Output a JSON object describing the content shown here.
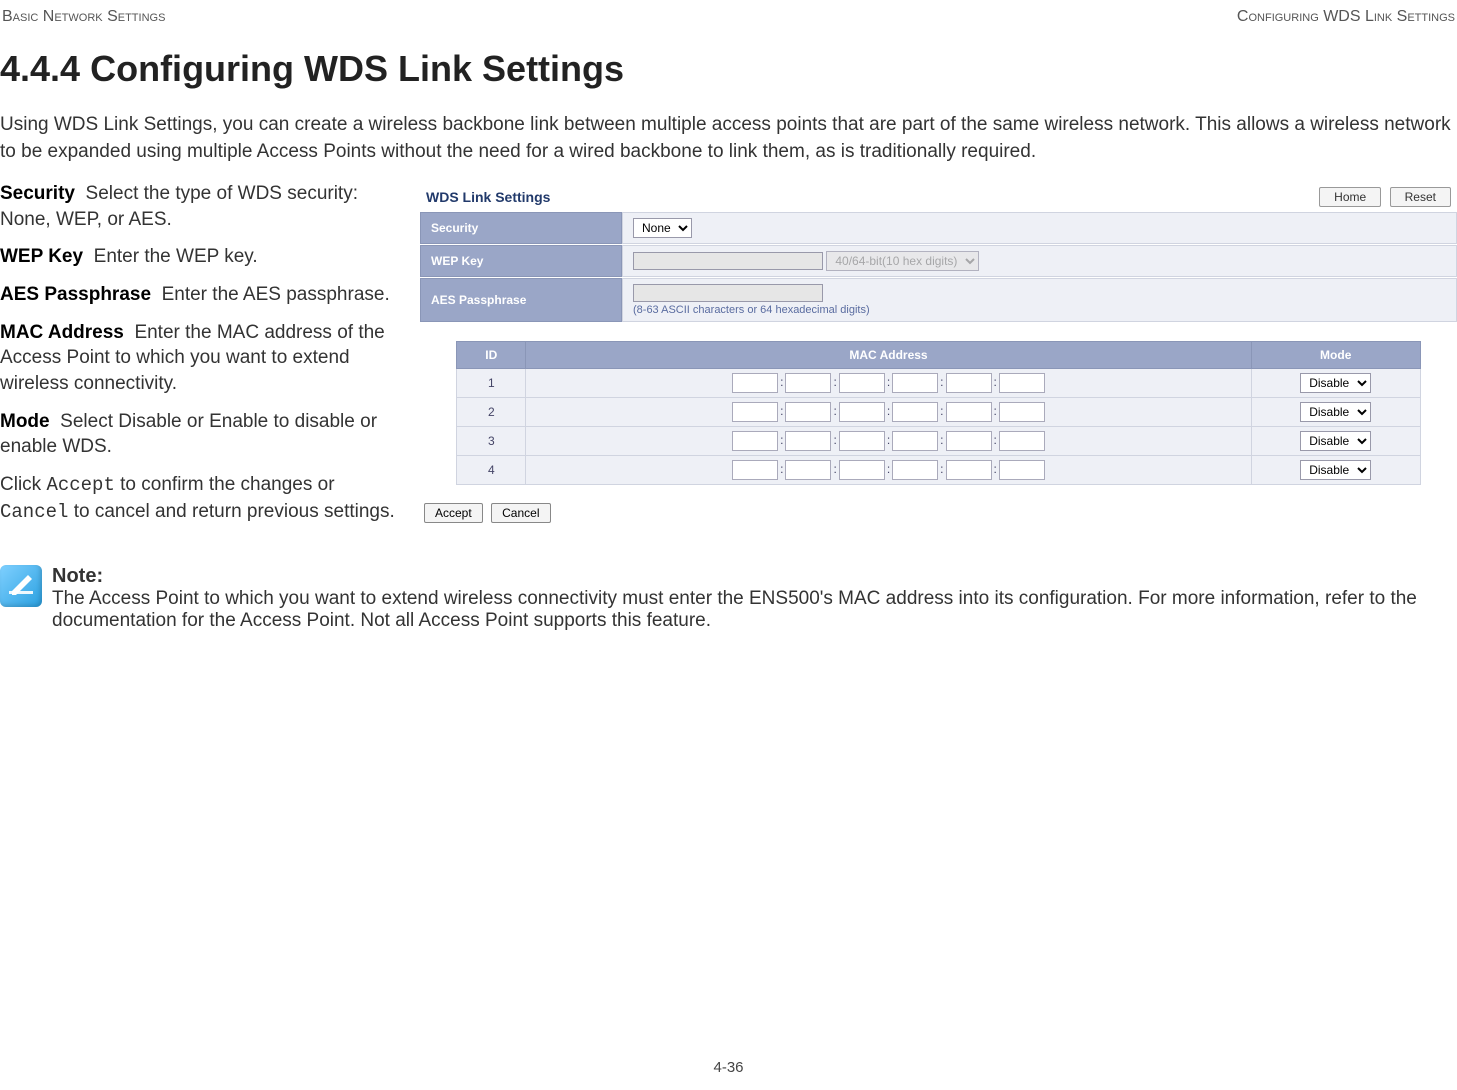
{
  "header": {
    "left": "Basic Network Settings",
    "right": "Configuring WDS Link Settings"
  },
  "section_number": "4.4.4",
  "section_title": "Configuring WDS Link Settings",
  "intro": "Using WDS Link Settings, you can create a wireless backbone link between multiple access points that are part of the same wireless network. This allows a wireless network to be expanded using multiple Access Points without the need for a wired backbone to link them, as is traditionally required.",
  "defs": {
    "security": {
      "term": "Security",
      "text": "Select the type of WDS security: None, WEP, or AES."
    },
    "wep": {
      "term": "WEP Key",
      "text": "Enter the WEP key."
    },
    "aes": {
      "term": "AES Passphrase",
      "text": "Enter the AES passphrase."
    },
    "mac": {
      "term": "MAC Address",
      "text": "Enter the MAC address of the Access Point to which you want to extend wireless connectivity."
    },
    "mode": {
      "term": "Mode",
      "text": "Select Disable or Enable to disable or enable WDS."
    },
    "click_pre": "Click ",
    "click_accept": "Accept",
    "click_mid": " to confirm the changes or ",
    "click_cancel": "Cancel",
    "click_post": " to cancel and return previous settings."
  },
  "figure": {
    "panel_title": "WDS Link Settings",
    "btn_home": "Home",
    "btn_reset": "Reset",
    "rows": {
      "security": {
        "label": "Security",
        "value": "None"
      },
      "wep": {
        "label": "WEP Key",
        "hint_sel": "40/64-bit(10 hex digits)"
      },
      "aes": {
        "label": "AES Passphrase",
        "hint": "(8-63 ASCII characters or 64 hexadecimal digits)"
      }
    },
    "mac_table": {
      "head_id": "ID",
      "head_mac": "MAC Address",
      "head_mode": "Mode",
      "rows": [
        {
          "id": "1",
          "mode": "Disable"
        },
        {
          "id": "2",
          "mode": "Disable"
        },
        {
          "id": "3",
          "mode": "Disable"
        },
        {
          "id": "4",
          "mode": "Disable"
        }
      ]
    },
    "btn_accept": "Accept",
    "btn_cancel": "Cancel"
  },
  "note": {
    "title": "Note:",
    "text": "The Access Point to which you want to extend wireless connectivity must enter the ENS500's MAC address into its configuration. For more information, refer to the documentation for the Access Point. Not all Access Point supports this feature."
  },
  "page_number": "4-36"
}
